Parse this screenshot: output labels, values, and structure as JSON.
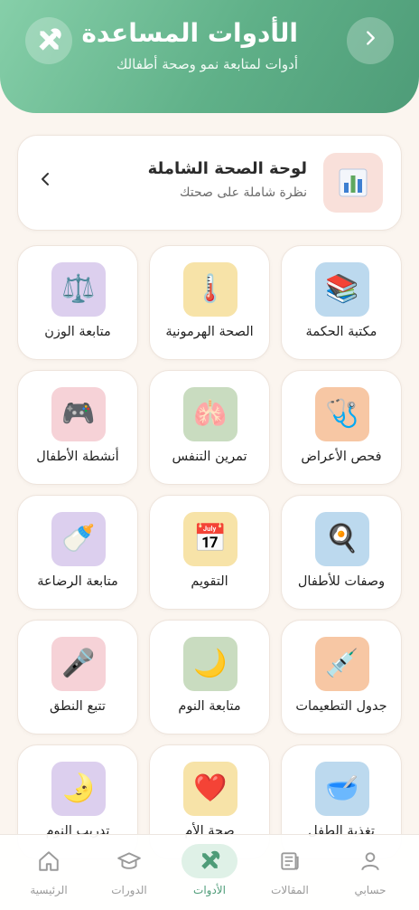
{
  "header": {
    "title": "الأدوات المساعدة",
    "subtitle": "أدوات لمتابعة نمو وصحة أطفالك",
    "back_icon": "chevron-right-icon",
    "tools_icon": "tools-icon"
  },
  "dashboard": {
    "title": "لوحة الصحة الشاملة",
    "subtitle": "نظرة شاملة على صحتك",
    "icon": "bar-chart-icon"
  },
  "tools": [
    {
      "label": "مكتبة الحكمة",
      "icon": "📚",
      "bg": "#bcd9ee"
    },
    {
      "label": "الصحة الهرمونية",
      "icon": "🌡️",
      "bg": "#f7e3a8"
    },
    {
      "label": "متابعة الوزن",
      "icon": "⚖️",
      "bg": "#dccfee"
    },
    {
      "label": "فحص الأعراض",
      "icon": "🩺",
      "bg": "#f7c7a4"
    },
    {
      "label": "تمرين التنفس",
      "icon": "🫁",
      "bg": "#c9dcc0"
    },
    {
      "label": "أنشطة الأطفال",
      "icon": "🎮",
      "bg": "#f6d2d7"
    },
    {
      "label": "وصفات للأطفال",
      "icon": "🍳",
      "bg": "#bcd9ee"
    },
    {
      "label": "التقويم",
      "icon": "📅",
      "bg": "#f7e3a8"
    },
    {
      "label": "متابعة الرضاعة",
      "icon": "🍼",
      "bg": "#dccfee"
    },
    {
      "label": "جدول التطعيمات",
      "icon": "💉",
      "bg": "#f7c7a4"
    },
    {
      "label": "متابعة النوم",
      "icon": "🌙",
      "bg": "#c9dcc0"
    },
    {
      "label": "تتبع النطق",
      "icon": "🎤",
      "bg": "#f6d2d7"
    },
    {
      "label": "تغذية الطفل",
      "icon": "🥣",
      "bg": "#bcd9ee"
    },
    {
      "label": "صحة الأم",
      "icon": "❤️",
      "bg": "#f7e3a8"
    },
    {
      "label": "تدريب النوم",
      "icon": "🌛",
      "bg": "#dccfee"
    }
  ],
  "nav": [
    {
      "label": "حسابي",
      "icon": "user-icon",
      "active": false
    },
    {
      "label": "المقالات",
      "icon": "newspaper-icon",
      "active": false
    },
    {
      "label": "الأدوات",
      "icon": "tools-icon",
      "active": true
    },
    {
      "label": "الدورات",
      "icon": "graduation-cap-icon",
      "active": false
    },
    {
      "label": "الرئيسية",
      "icon": "home-icon",
      "active": false
    }
  ],
  "colors": {
    "accent": "#4e9c78",
    "background": "#fbf5ef"
  }
}
